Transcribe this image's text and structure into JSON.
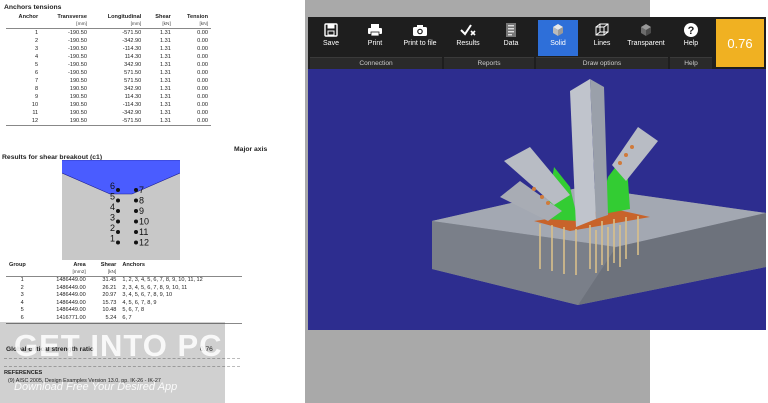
{
  "report": {
    "anchors_title": "Anchors tensions",
    "anchors_cols": [
      "Anchor",
      "Transverse",
      "Longitudinal",
      "Shear",
      "Tension"
    ],
    "anchors_units": [
      "",
      "[mm]",
      "[mm]",
      "[kN]",
      "[kN]"
    ],
    "anchors_rows": [
      [
        "1",
        "-190.50",
        "-571.50",
        "1.31",
        "0.00"
      ],
      [
        "2",
        "-190.50",
        "-342.90",
        "1.31",
        "0.00"
      ],
      [
        "3",
        "-190.50",
        "-114.30",
        "1.31",
        "0.00"
      ],
      [
        "4",
        "-190.50",
        "114.30",
        "1.31",
        "0.00"
      ],
      [
        "5",
        "-190.50",
        "342.90",
        "1.31",
        "0.00"
      ],
      [
        "6",
        "-190.50",
        "571.50",
        "1.31",
        "0.00"
      ],
      [
        "7",
        "190.50",
        "571.50",
        "1.31",
        "0.00"
      ],
      [
        "8",
        "190.50",
        "342.90",
        "1.31",
        "0.00"
      ],
      [
        "9",
        "190.50",
        "114.30",
        "1.31",
        "0.00"
      ],
      [
        "10",
        "190.50",
        "-114.30",
        "1.31",
        "0.00"
      ],
      [
        "11",
        "190.50",
        "-342.90",
        "1.31",
        "0.00"
      ],
      [
        "12",
        "190.50",
        "-571.50",
        "1.31",
        "0.00"
      ]
    ],
    "shear_title": "Results for shear breakout (c1)",
    "major_axis": "Major axis",
    "diagram_left_labels": [
      "6",
      "5",
      "4",
      "3",
      "2",
      "1"
    ],
    "diagram_right_labels": [
      "7",
      "8",
      "9",
      "10",
      "11",
      "12"
    ],
    "group_cols": [
      "Group",
      "Area",
      "Shear",
      "Anchors"
    ],
    "group_units": [
      "",
      "[mm2]",
      "[kN]",
      ""
    ],
    "group_rows": [
      [
        "1",
        "1486449.00",
        "31.45",
        "1, 2, 3, 4, 5, 6, 7, 8, 9, 10, 11, 12"
      ],
      [
        "2",
        "1486449.00",
        "26.21",
        "2, 3, 4, 5, 6, 7, 8, 9, 10, 11"
      ],
      [
        "3",
        "1486449.00",
        "20.97",
        "3, 4, 5, 6, 7, 8, 9, 10"
      ],
      [
        "4",
        "1486449.00",
        "15.73",
        "4, 5, 6, 7, 8, 9"
      ],
      [
        "5",
        "1486449.00",
        "10.48",
        "5, 6, 7, 8"
      ],
      [
        "6",
        "1416771.00",
        "5.24",
        "6, 7"
      ]
    ],
    "global_label": "Global critical strength ratio",
    "global_value": "0.76",
    "references_title": "REFERENCES",
    "references_text": "(9) AISC 2005, Design Examples Version 13.0, pp. IK-26 - IK-27"
  },
  "ribbon": {
    "connection": {
      "label": "Connection",
      "buttons": [
        {
          "label": "Save",
          "icon": "save-icon"
        },
        {
          "label": "Print",
          "icon": "print-icon"
        },
        {
          "label": "Print to file",
          "icon": "camera-icon"
        }
      ]
    },
    "reports": {
      "label": "Reports",
      "buttons": [
        {
          "label": "Results",
          "icon": "results-icon"
        },
        {
          "label": "Data",
          "icon": "data-icon"
        }
      ]
    },
    "draw": {
      "label": "Draw options",
      "buttons": [
        {
          "label": "Solid",
          "icon": "solid-cube-icon"
        },
        {
          "label": "Lines",
          "icon": "wireframe-cube-icon"
        },
        {
          "label": "Transparent",
          "icon": "transparent-cube-icon"
        }
      ]
    },
    "help": {
      "label": "Help",
      "buttons": [
        {
          "label": "Help",
          "icon": "question-icon"
        }
      ]
    },
    "score": "0.76"
  },
  "watermark": {
    "main": "GET INTO PC",
    "sub": "Download Free Your Desired App"
  },
  "colors": {
    "viewport_bg": "#2d2d8f",
    "active_button": "#2e6fd9",
    "score_bg": "#f0b122",
    "breakout_area": "#4a5cff",
    "plate_green": "#33cc33",
    "concrete": "#8a8f9a"
  }
}
